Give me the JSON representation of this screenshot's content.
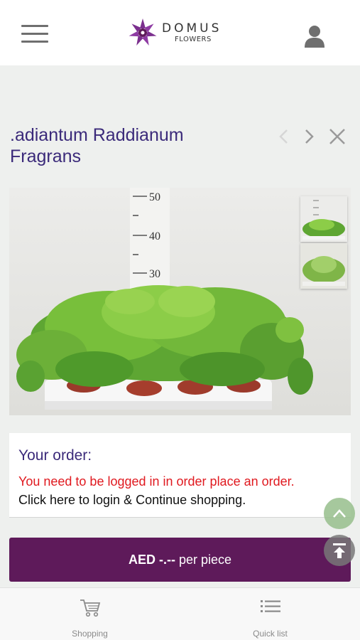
{
  "header": {
    "logo_main": "DOMUS",
    "logo_sub": "FLOWERS",
    "brand_color": "#6b2c7f"
  },
  "product": {
    "title": ".adiantum Raddianum Fragrans",
    "scale_labels": [
      "50",
      "40",
      "30"
    ]
  },
  "order": {
    "title": "Your order:",
    "login_warning": "You need to be logged in in order place an order.",
    "login_link": "Click here to login & Continue shopping."
  },
  "price_button": {
    "amount": "AED -.--",
    "unit": "per piece",
    "color": "#5e1a5a"
  },
  "bottom_nav": {
    "tabs": [
      {
        "label": "Shopping",
        "icon": "cart-icon"
      },
      {
        "label": "Quick list",
        "icon": "list-icon"
      }
    ]
  },
  "colors": {
    "title": "#3b2a7a",
    "warning": "#e0191f"
  }
}
